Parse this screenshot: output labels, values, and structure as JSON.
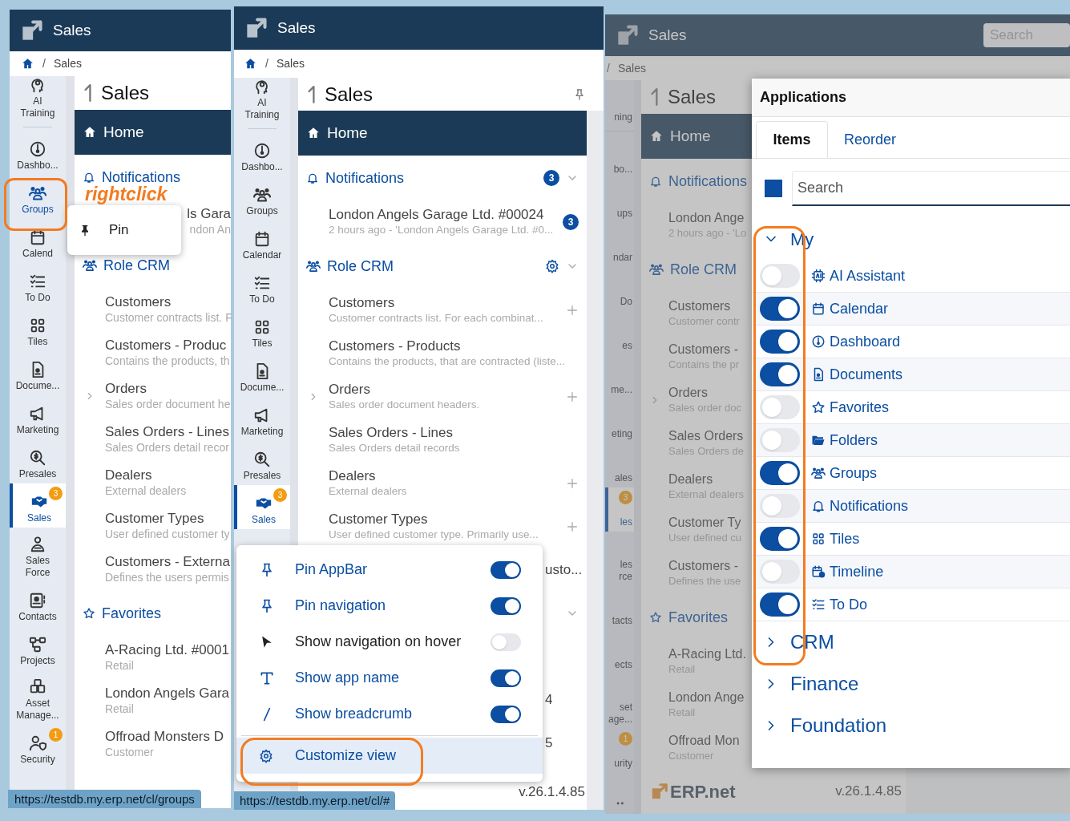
{
  "left_window": {
    "app_title": "Sales",
    "breadcrumb": {
      "separator": "/",
      "current": "Sales"
    },
    "sidebar": [
      {
        "label": "AI\nTraining",
        "selected": false,
        "hovered": false
      },
      {
        "label": "Dashbo...",
        "selected": false,
        "hovered": false
      },
      {
        "label": "Groups",
        "selected": false,
        "hovered": true
      },
      {
        "label": "Calend",
        "selected": false,
        "hovered": false
      },
      {
        "label": "To Do",
        "selected": false,
        "hovered": false
      },
      {
        "label": "Tiles",
        "selected": false,
        "hovered": false
      },
      {
        "label": "Docume...",
        "selected": false,
        "hovered": false
      },
      {
        "label": "Marketing",
        "selected": false,
        "hovered": false
      },
      {
        "label": "Presales",
        "selected": false,
        "hovered": false
      },
      {
        "label": "Sales",
        "selected": true,
        "hovered": false,
        "badge": "3"
      },
      {
        "label": "Sales\nForce",
        "selected": false,
        "hovered": false
      },
      {
        "label": "Contacts",
        "selected": false,
        "hovered": false
      },
      {
        "label": "Projects",
        "selected": false,
        "hovered": false
      },
      {
        "label": "Asset\nManage...",
        "selected": false,
        "hovered": false
      },
      {
        "label": "Security",
        "selected": false,
        "hovered": false,
        "badge": "1"
      }
    ],
    "page_title": "Sales",
    "home": "Home",
    "content": [
      {
        "kind": "section",
        "label": "Notifications"
      },
      {
        "kind": "covered",
        "title": "ls Gara",
        "subtitle": "ndon An"
      },
      {
        "kind": "section",
        "label": "Role CRM"
      },
      {
        "kind": "entry",
        "title": "Customers",
        "subtitle": "Customer contracts list. F",
        "expandable": false
      },
      {
        "kind": "entry",
        "title": "Customers - Produc",
        "subtitle": "Contains the products, th",
        "expandable": false
      },
      {
        "kind": "entry",
        "title": "Orders",
        "subtitle": "Sales order document he",
        "expandable": true
      },
      {
        "kind": "entry",
        "title": "Sales Orders - Lines",
        "subtitle": "Sales Orders detail recor",
        "expandable": false
      },
      {
        "kind": "entry",
        "title": "Dealers",
        "subtitle": "External dealers",
        "expandable": false
      },
      {
        "kind": "entry",
        "title": "Customer Types",
        "subtitle": "User defined customer ty",
        "expandable": false
      },
      {
        "kind": "entry",
        "title": "Customers - Externa",
        "subtitle": "Defines the users permis",
        "expandable": false
      },
      {
        "kind": "section",
        "label": "Favorites"
      },
      {
        "kind": "entry",
        "title": "A-Racing Ltd. #0001",
        "subtitle": "Retail",
        "expandable": false
      },
      {
        "kind": "entry",
        "title": "London Angels Gara",
        "subtitle": "Retail",
        "expandable": false
      },
      {
        "kind": "entry",
        "title": "Offroad Monsters D",
        "subtitle": "Customer",
        "expandable": false
      }
    ],
    "context_menu": {
      "item": "Pin"
    },
    "annotation": "rightclick",
    "status_url": "https://testdb.my.erp.net/cl/groups"
  },
  "middle_window": {
    "app_title": "Sales",
    "breadcrumb": {
      "separator": "/",
      "current": "Sales"
    },
    "sidebar": [
      {
        "label": "AI\nTraining",
        "selected": false
      },
      {
        "label": "Dashbo...",
        "selected": false
      },
      {
        "label": "Groups",
        "selected": false
      },
      {
        "label": "Calendar",
        "selected": false
      },
      {
        "label": "To Do",
        "selected": false
      },
      {
        "label": "Tiles",
        "selected": false
      },
      {
        "label": "Docume...",
        "selected": false
      },
      {
        "label": "Marketing",
        "selected": false
      },
      {
        "label": "Presales",
        "selected": false
      },
      {
        "label": "Sales",
        "selected": true,
        "badge": "3"
      }
    ],
    "page_title": "Sales",
    "home": "Home",
    "content": [
      {
        "kind": "section",
        "label": "Notifications",
        "badge": "3",
        "collapsible": true
      },
      {
        "kind": "entry",
        "title": "London Angels Garage Ltd. #00024",
        "subtitle": "2 hours ago - 'London Angels Garage Ltd. #0...",
        "badge": "3",
        "expandable": false,
        "addable": false
      },
      {
        "kind": "section",
        "label": "Role CRM",
        "settings": true,
        "collapsible": true
      },
      {
        "kind": "entry",
        "title": "Customers",
        "subtitle": "Customer contracts list. For each combinat...",
        "expandable": false,
        "addable": true
      },
      {
        "kind": "entry",
        "title": "Customers - Products",
        "subtitle": "Contains the products, that are contracted (liste...",
        "expandable": false,
        "addable": false
      },
      {
        "kind": "entry",
        "title": "Orders",
        "subtitle": "Sales order document headers.",
        "expandable": true,
        "addable": true
      },
      {
        "kind": "entry",
        "title": "Sales Orders - Lines",
        "subtitle": "Sales Orders detail records",
        "expandable": false,
        "addable": false
      },
      {
        "kind": "entry",
        "title": "Dealers",
        "subtitle": "External dealers",
        "expandable": false,
        "addable": true
      },
      {
        "kind": "entry",
        "title": "Customer Types",
        "subtitle": "User defined customer type. Primarily use...",
        "expandable": false,
        "addable": true
      },
      {
        "kind": "fragment",
        "text": "usto..."
      },
      {
        "kind": "fragment_chevron"
      },
      {
        "kind": "fragment",
        "text": "4"
      },
      {
        "kind": "fragment",
        "text": "5"
      }
    ],
    "settings_menu": {
      "items": [
        {
          "label": "Pin AppBar",
          "on": true
        },
        {
          "label": "Pin navigation",
          "on": true
        },
        {
          "label": "Show navigation on hover",
          "on": false
        },
        {
          "label": "Show app name",
          "on": true
        },
        {
          "label": "Show breadcrumb",
          "on": true
        }
      ],
      "action": {
        "label": "Customize view",
        "highlighted": true
      }
    },
    "version": "v.26.1.4.85",
    "status_url": "https://testdb.my.erp.net/cl/#"
  },
  "right_window": {
    "app_title": "Sales",
    "search": {
      "placeholder": "Search"
    },
    "breadcrumb": {
      "separator": "/",
      "current": "Sales"
    },
    "sidebar": [
      {
        "label": "ning",
        "selected": false
      },
      {
        "label": "bo...",
        "selected": false
      },
      {
        "label": "ups",
        "selected": false
      },
      {
        "label": "ndar",
        "selected": false
      },
      {
        "label": "Do",
        "selected": false
      },
      {
        "label": "es",
        "selected": false
      },
      {
        "label": "me...",
        "selected": false
      },
      {
        "label": "eting",
        "selected": false
      },
      {
        "label": "ales",
        "selected": false
      },
      {
        "label": "les",
        "selected": true,
        "badge": "3"
      },
      {
        "label": "les\nrce",
        "selected": false
      },
      {
        "label": "tacts",
        "selected": false
      },
      {
        "label": "ects",
        "selected": false
      },
      {
        "label": "set\nage...",
        "selected": false
      },
      {
        "label": "urity",
        "selected": false,
        "badge": "1"
      }
    ],
    "page_title": "Sales",
    "home": "Home",
    "content": [
      {
        "kind": "section",
        "label": "Notifications"
      },
      {
        "kind": "entry",
        "title": "London Ange",
        "subtitle": "2 hours ago - 'Lo",
        "expandable": false
      },
      {
        "kind": "section",
        "label": "Role CRM"
      },
      {
        "kind": "entry",
        "title": "Customers",
        "subtitle": "Customer contr",
        "expandable": false
      },
      {
        "kind": "entry",
        "title": "Customers -",
        "subtitle": "Contains the pr",
        "expandable": false
      },
      {
        "kind": "entry",
        "title": "Orders",
        "subtitle": "Sales order doc",
        "expandable": true
      },
      {
        "kind": "entry",
        "title": "Sales Orders",
        "subtitle": "Sales Orders de",
        "expandable": false
      },
      {
        "kind": "entry",
        "title": "Dealers",
        "subtitle": "External dealers",
        "expandable": false
      },
      {
        "kind": "entry",
        "title": "Customer Ty",
        "subtitle": "User defined cu",
        "expandable": false
      },
      {
        "kind": "entry",
        "title": "Customers -",
        "subtitle": "Defines the use",
        "expandable": false
      },
      {
        "kind": "section",
        "label": "Favorites"
      },
      {
        "kind": "entry",
        "title": "A-Racing Ltd.",
        "subtitle": "Retail",
        "expandable": false
      },
      {
        "kind": "entry",
        "title": "London Ange",
        "subtitle": "Retail",
        "expandable": false
      },
      {
        "kind": "entry",
        "title": "Offroad Mon",
        "subtitle": "Customer",
        "expandable": false
      }
    ],
    "footer": {
      "logo": "ERP.net",
      "version": "v.26.1.4.85"
    },
    "dialog": {
      "title": "Applications",
      "tabs": [
        {
          "label": "Items",
          "selected": true
        },
        {
          "label": "Reorder",
          "selected": false
        }
      ],
      "select_all": {
        "checked": true
      },
      "search": {
        "placeholder": "Search"
      },
      "groups": [
        {
          "label": "My",
          "expanded": true,
          "children": [
            {
              "label": "AI Assistant",
              "on": false
            },
            {
              "label": "Calendar",
              "on": true
            },
            {
              "label": "Dashboard",
              "on": true
            },
            {
              "label": "Documents",
              "on": true
            },
            {
              "label": "Favorites",
              "on": false
            },
            {
              "label": "Folders",
              "on": false
            },
            {
              "label": "Groups",
              "on": true
            },
            {
              "label": "Notifications",
              "on": false
            },
            {
              "label": "Tiles",
              "on": true
            },
            {
              "label": "Timeline",
              "on": false
            },
            {
              "label": "To Do",
              "on": true
            }
          ]
        },
        {
          "label": "CRM",
          "expanded": false
        },
        {
          "label": "Finance",
          "expanded": false
        },
        {
          "label": "Foundation",
          "expanded": false
        }
      ]
    }
  }
}
